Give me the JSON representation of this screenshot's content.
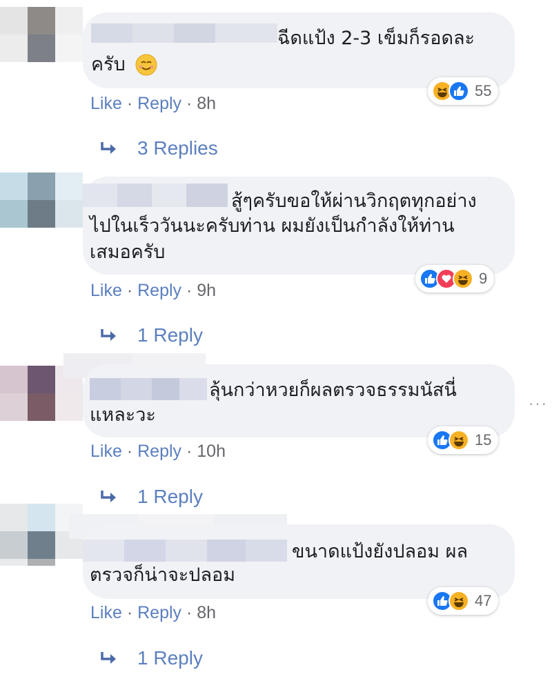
{
  "comments": [
    {
      "text": "ฉีดแป้ง 2-3 เข็มก็รอดละครับ",
      "line1": "ฉีดแป้ง 2-3 เข็มก็รอดละ",
      "line2": "ครับ",
      "emoji": "smiling-face-emoji",
      "actions": {
        "like": "Like",
        "reply": "Reply",
        "time": "8h"
      },
      "reactions": {
        "types": [
          "haha",
          "like"
        ],
        "count": "55"
      },
      "replies": "3 Replies"
    },
    {
      "line1": "สู้ๆครับขอให้ผ่านวิกฤตทุกอย่าง",
      "line2": "ไปในเร็ววันนะครับท่าน ผมยังเป็นกำลังให้ท่าน",
      "line3": "เสมอครับ",
      "actions": {
        "like": "Like",
        "reply": "Reply",
        "time": "9h"
      },
      "reactions": {
        "types": [
          "like",
          "love",
          "haha"
        ],
        "count": "9"
      },
      "replies": "1 Reply"
    },
    {
      "line1": "ลุ้นกว่าหวยก็ผลตรวจธรรมนัสนี่",
      "line2": "แหละวะ",
      "actions": {
        "like": "Like",
        "reply": "Reply",
        "time": "10h"
      },
      "reactions": {
        "types": [
          "like",
          "haha"
        ],
        "count": "15"
      },
      "replies": "1 Reply"
    },
    {
      "line1": "ขนาดแป้งยังปลอม ผล",
      "line2": "ตรวจก็น่าจะปลอม",
      "actions": {
        "like": "Like",
        "reply": "Reply",
        "time": "8h"
      },
      "reactions": {
        "types": [
          "like",
          "haha"
        ],
        "count": "47"
      },
      "replies": "1 Reply"
    }
  ],
  "more_options": "···",
  "colors": {
    "bubble": "#f0f2f5",
    "link": "#5b7fbf",
    "meta": "#65676b",
    "like": "#1877f2",
    "haha": "#f7b125",
    "love": "#f33e58"
  }
}
